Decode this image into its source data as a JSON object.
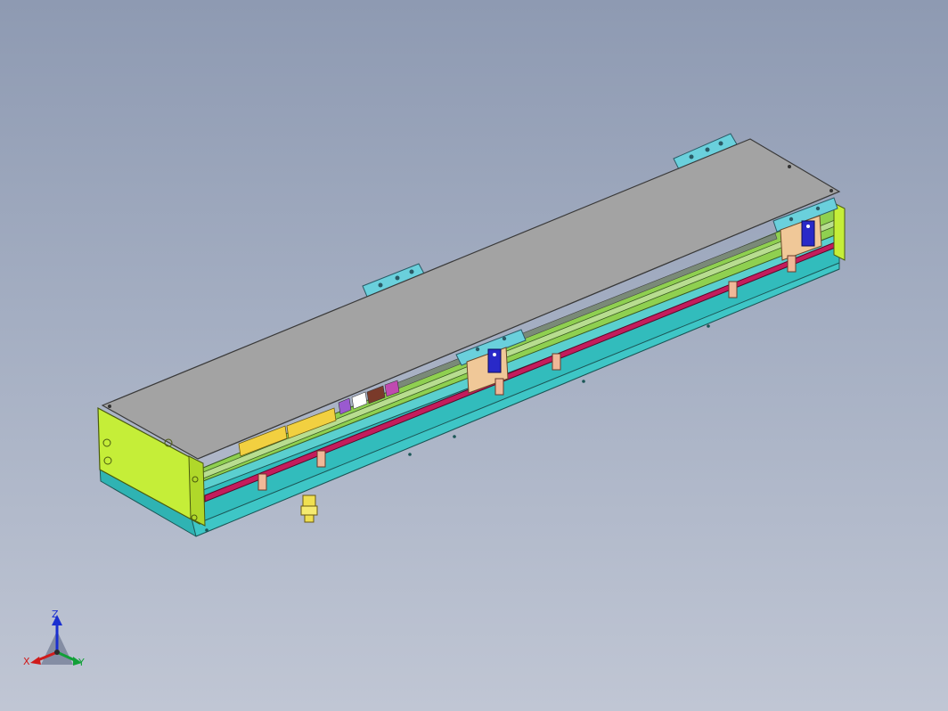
{
  "viewport": {
    "background_top": "#8e9ab2",
    "background_bottom": "#c0c6d4"
  },
  "model": {
    "colors": {
      "top_cover": "#a3a3a3",
      "base_plate": "#2fb3b3",
      "end_plate": "#c5ee38",
      "rail": "#c41c5c",
      "carriage_block": "#f0c898",
      "bracket": "#6ad0dc",
      "motor_mount": "#2929c8",
      "fitting": "#f0e050"
    }
  },
  "triad": {
    "z_label": "Z",
    "x_label": "X",
    "y_label": "Y",
    "z_color": "#1a2fd0",
    "x_color": "#d01a1a",
    "y_color": "#12a038"
  }
}
